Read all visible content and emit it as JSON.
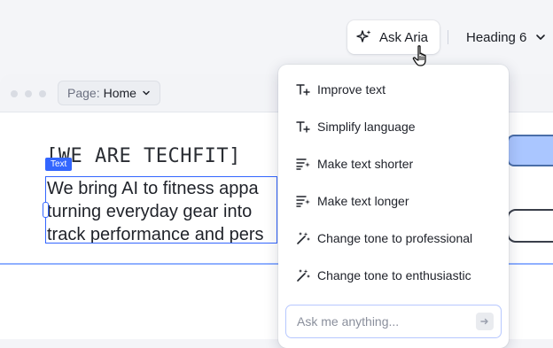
{
  "toolbar": {
    "ask_aria_label": "Ask Aria",
    "heading_select_value": "Heading 6"
  },
  "browser": {
    "page_label": "Page:",
    "page_value": "Home"
  },
  "canvas": {
    "headline": "[WE ARE TECHFIT]",
    "text_tag": "Text",
    "body_lines": [
      "We bring AI to fitness appa",
      "turning everyday gear into",
      "track performance and pers"
    ]
  },
  "menu": {
    "items": [
      {
        "label": "Improve text",
        "icon": "text-improve-icon"
      },
      {
        "label": "Simplify language",
        "icon": "text-simplify-icon"
      },
      {
        "label": "Make text shorter",
        "icon": "text-shorter-icon"
      },
      {
        "label": "Make text longer",
        "icon": "text-longer-icon"
      },
      {
        "label": "Change tone to professional",
        "icon": "magic-wand-icon"
      },
      {
        "label": "Change tone to enthusiastic",
        "icon": "magic-wand-icon"
      }
    ],
    "input_placeholder": "Ask me anything..."
  },
  "colors": {
    "accent": "#3366ff",
    "selection_outline": "#3366ff",
    "background": "#f4f5f8"
  }
}
